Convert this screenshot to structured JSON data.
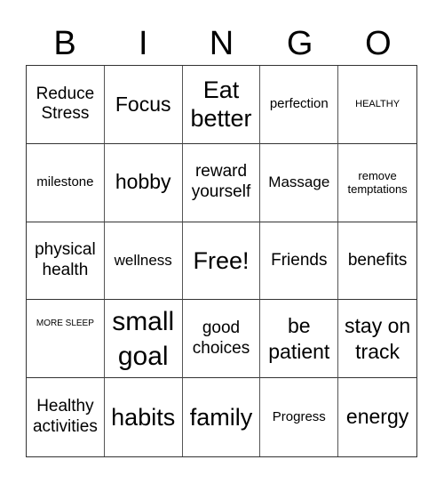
{
  "header": {
    "letters": [
      "B",
      "I",
      "N",
      "G",
      "O"
    ]
  },
  "cells": [
    "Reduce Stress",
    "Focus",
    "Eat better",
    "perfection",
    "HEALTHY",
    "milestone",
    "hobby",
    "reward yourself",
    "Massage",
    "remove temptations",
    "physical health",
    "wellness",
    "Free!",
    "Friends",
    "benefits",
    "MORE SLEEP",
    "small goal",
    "good choices",
    "be patient",
    "stay on track",
    "Healthy activities",
    "habits",
    "family",
    "Progress",
    "energy"
  ]
}
